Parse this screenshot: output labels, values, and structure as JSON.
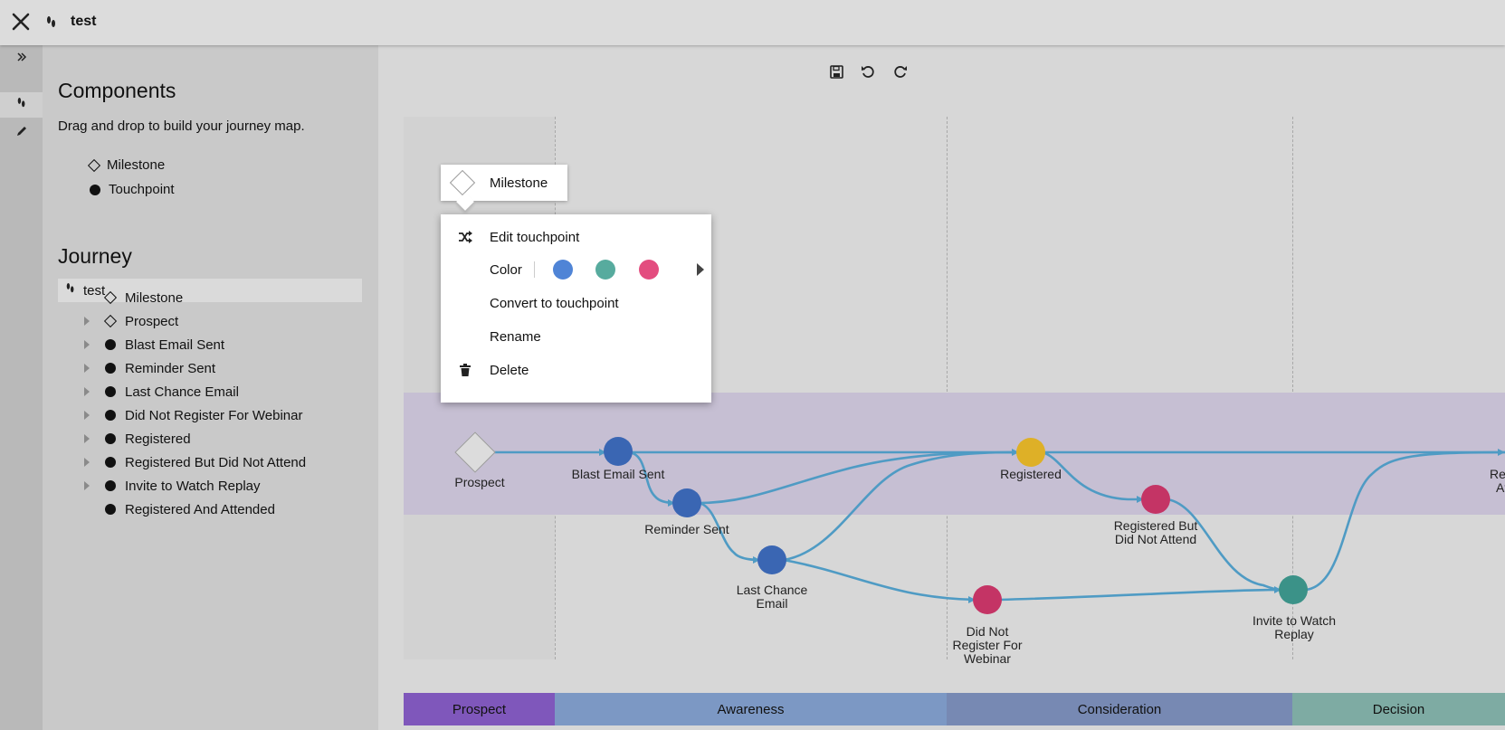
{
  "header": {
    "title": "test",
    "close_icon": "close-icon",
    "journey_icon": "footsteps-icon"
  },
  "rail": {
    "items": [
      {
        "icon": "expand-chevrons-icon"
      },
      {
        "icon": "footsteps-icon"
      },
      {
        "icon": "pencil-icon"
      }
    ]
  },
  "components": {
    "title": "Components",
    "subtitle": "Drag and drop to build your journey map.",
    "items": [
      {
        "label": "Milestone",
        "icon": "diamond-icon"
      },
      {
        "label": "Touchpoint",
        "icon": "dot-icon"
      }
    ]
  },
  "journey": {
    "title": "Journey",
    "root": "test",
    "items": [
      {
        "label": "Milestone",
        "icon": "diamond-icon",
        "expandable": false
      },
      {
        "label": "Prospect",
        "icon": "diamond-icon",
        "expandable": true
      },
      {
        "label": "Blast Email Sent",
        "icon": "dot-icon",
        "expandable": true
      },
      {
        "label": "Reminder Sent",
        "icon": "dot-icon",
        "expandable": true
      },
      {
        "label": "Last Chance Email",
        "icon": "dot-icon",
        "expandable": true
      },
      {
        "label": "Did Not Register For Webinar",
        "icon": "dot-icon",
        "expandable": true
      },
      {
        "label": "Registered",
        "icon": "dot-icon",
        "expandable": true
      },
      {
        "label": "Registered But Did Not Attend",
        "icon": "dot-icon",
        "expandable": true
      },
      {
        "label": "Invite to Watch Replay",
        "icon": "dot-icon",
        "expandable": true
      },
      {
        "label": "Registered And Attended",
        "icon": "dot-icon",
        "expandable": false
      }
    ]
  },
  "toolbar": {
    "icons": [
      "save-icon",
      "undo-icon",
      "redo-icon"
    ]
  },
  "stages": [
    {
      "label": "Prospect",
      "color": "#7f57bb"
    },
    {
      "label": "Awareness",
      "color": "#7c98c4"
    },
    {
      "label": "Consideration",
      "color": "#7789b3"
    },
    {
      "label": "Decision",
      "color": "#7eaba3"
    }
  ],
  "map": {
    "line_color": "#4f9bc4",
    "band_color": "#c6bfd3",
    "milestone": {
      "label": "Prospect"
    },
    "touchpoints": [
      {
        "label": "Blast Email Sent",
        "color": "#3a66b3"
      },
      {
        "label": "Reminder Sent",
        "color": "#3a66b3"
      },
      {
        "label": "Last Chance Email",
        "color": "#3a66b3"
      },
      {
        "label": "Registered",
        "color": "#deb027"
      },
      {
        "label": "Registered But Did Not Attend",
        "color": "#c43465"
      },
      {
        "label": "Did Not Register For Webinar",
        "color": "#c43465"
      },
      {
        "label": "Invite to Watch Replay",
        "color": "#3b9288"
      },
      {
        "label": "Regis At",
        "color": "#3a66b3"
      }
    ],
    "label_lines": {
      "blast": "Blast Email Sent",
      "reminder": "Reminder Sent",
      "lastchance_1": "Last Chance",
      "lastchance_2": "Email",
      "registered": "Registered",
      "rbdna_1": "Registered But",
      "rbdna_2": "Did Not Attend",
      "dnr_1": "Did Not",
      "dnr_2": "Register For",
      "dnr_3": "Webinar",
      "invite_1": "Invite to Watch",
      "invite_2": "Replay",
      "partial_1": "Regis",
      "partial_2": "At"
    }
  },
  "tooltip": {
    "label": "Milestone",
    "icon": "diamond-icon"
  },
  "context_menu": {
    "edit": {
      "label": "Edit touchpoint",
      "icon": "shuffle-icon"
    },
    "color": {
      "label": "Color",
      "swatches": [
        "#4f84d6",
        "#57ab9e",
        "#e34d7f"
      ],
      "more_icon": "triangle-right-icon"
    },
    "convert": {
      "label": "Convert to touchpoint"
    },
    "rename": {
      "label": "Rename"
    },
    "delete": {
      "label": "Delete",
      "icon": "trash-icon"
    }
  }
}
